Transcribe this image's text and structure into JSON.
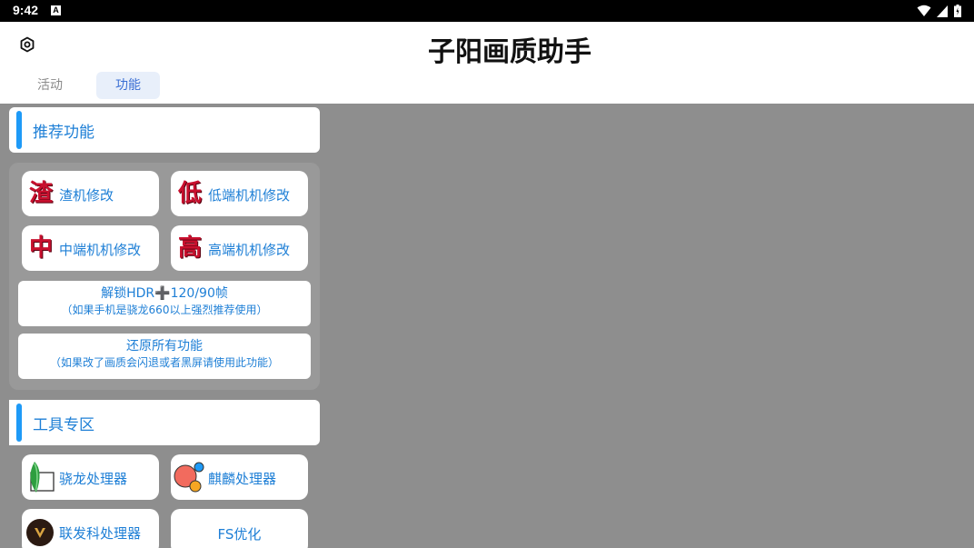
{
  "status_bar": {
    "time": "9:42",
    "notification_glyph": "A"
  },
  "app_bar": {
    "title": "子阳画质助手",
    "settings_icon": "settings-icon"
  },
  "tabs": [
    {
      "label": "活动",
      "selected": false
    },
    {
      "label": "功能",
      "selected": true
    }
  ],
  "sections": {
    "recommended": {
      "title": "推荐功能"
    },
    "tools": {
      "title": "工具专区"
    }
  },
  "recommended_buttons": [
    {
      "glyph": "渣",
      "label": "渣机修改"
    },
    {
      "glyph": "低",
      "label": "低端机机修改"
    },
    {
      "glyph": "中",
      "label": "中端机机修改"
    },
    {
      "glyph": "高",
      "label": "高端机机修改"
    }
  ],
  "hdr_button": {
    "line1_prefix": "解锁HDR",
    "line1_plus": "➕",
    "line1_suffix": "120/90帧",
    "line2": "（如果手机是骁龙660以上强烈推荐使用）"
  },
  "restore_button": {
    "line1": "还原所有功能",
    "line2": "（如果改了画质会闪退或者黑屏请使用此功能）"
  },
  "tool_buttons": [
    {
      "label": "骁龙处理器",
      "icon": "snapdragon-icon"
    },
    {
      "label": "麒麟处理器",
      "icon": "kirin-icon"
    },
    {
      "label": "联发科处理器",
      "icon": "mediatek-icon"
    },
    {
      "label": "FS优化",
      "icon": ""
    }
  ],
  "colors": {
    "accent": "#1e9af7",
    "text_blue": "#1e7fd6",
    "glyph_red": "#c8102e",
    "background_gray": "#8e8e8e"
  }
}
